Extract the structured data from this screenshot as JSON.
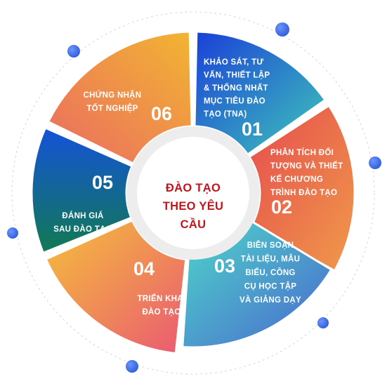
{
  "center": {
    "lines": [
      "ĐÀO TẠO",
      "THEO YÊU",
      "CẦU"
    ]
  },
  "segments": [
    {
      "number": "01",
      "lines": [
        "KHẢO SÁT, TƯ",
        "VẤN, THIẾT LẬP",
        "& THỐNG NHẤT",
        "MỤC TIÊU ĐÀO",
        "TẠO (TNA)"
      ],
      "colors": [
        "#1a3fd8",
        "#3fc8b9"
      ]
    },
    {
      "number": "02",
      "lines": [
        "PHÂN TÍCH ĐỐI",
        "TƯỢNG VÀ THIẾT",
        "KẾ CHƯƠNG",
        "TRÌNH ĐÀO TẠO"
      ],
      "colors": [
        "#e64b4e",
        "#f09a4a"
      ]
    },
    {
      "number": "03",
      "lines": [
        "BIÊN SOẠN",
        "TÀI LIỆU, MẪU",
        "BIỂU, CÔNG",
        "CỤ HỌC TẬP",
        "VÀ GIẢNG DẠY"
      ],
      "colors": [
        "#4ed7c9",
        "#4a66cf"
      ]
    },
    {
      "number": "04",
      "lines": [
        "TRIỂN KHAI",
        "ĐÀO TẠO"
      ],
      "colors": [
        "#f5c03a",
        "#ea5a73"
      ]
    },
    {
      "number": "05",
      "lines": [
        "ĐÁNH GIÁ",
        "SAU ĐÀO TẠO"
      ],
      "colors": [
        "#1452d9",
        "#127a52"
      ]
    },
    {
      "number": "06",
      "lines": [
        "CHỨNG NHẬN",
        "TỐT NGHIỆP"
      ],
      "colors": [
        "#eb6a63",
        "#f2b531"
      ]
    }
  ],
  "palette": {
    "ring_dots": "#2f5ed8",
    "center_text": "#c0171f",
    "dashed_ring": "#d7d7d7"
  }
}
